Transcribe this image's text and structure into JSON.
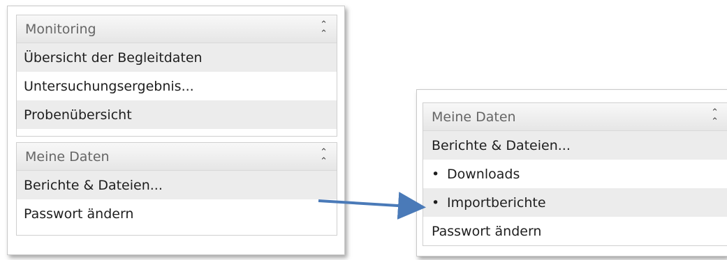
{
  "left": {
    "monitoring": {
      "title": "Monitoring",
      "items": [
        "Übersicht der Begleitdaten",
        "Untersuchungsergebnis...",
        "Probenübersicht"
      ]
    },
    "meine_daten": {
      "title": "Meine Daten",
      "items": [
        "Berichte & Dateien...",
        "Passwort ändern"
      ]
    }
  },
  "right": {
    "meine_daten": {
      "title": "Meine Daten",
      "item_reports": "Berichte & Dateien...",
      "sub_items": [
        "Downloads",
        "Importberichte"
      ],
      "item_password": "Passwort ändern",
      "bullet": "•"
    }
  },
  "icons": {
    "collapse": "collapse-up-icon",
    "arrow": "arrow-right-icon"
  },
  "colors": {
    "arrow": "#4a7ab8",
    "row_alt": "#ececec",
    "header_text": "#666666"
  }
}
